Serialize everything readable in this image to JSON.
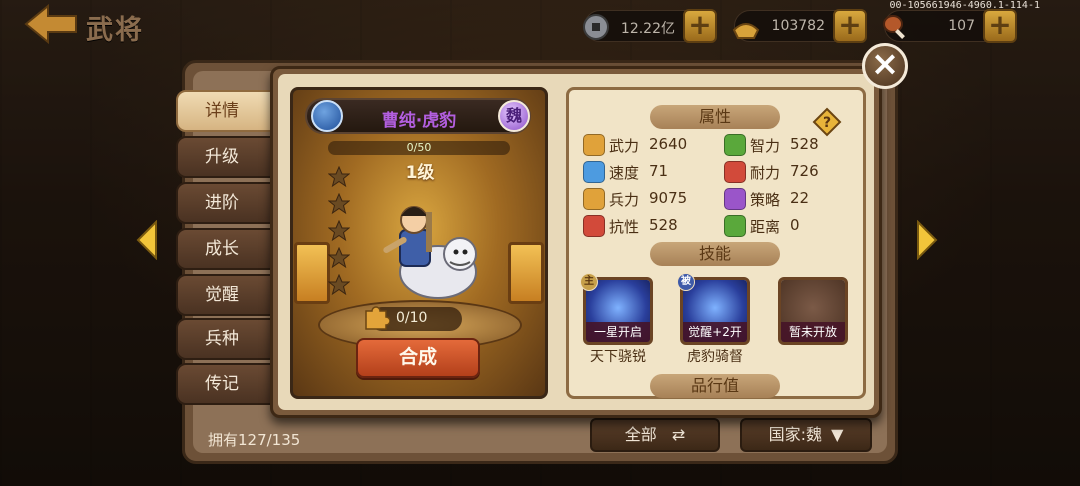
{
  "header": {
    "title": "武将",
    "server_code": "00-105661946-4960.1-114-1",
    "resources": [
      {
        "icon": "coin-icon",
        "value": "12.22亿"
      },
      {
        "icon": "gold-ingot-icon",
        "value": "103782"
      },
      {
        "icon": "drumstick-icon",
        "value": "107"
      }
    ]
  },
  "side_tabs": [
    "详情",
    "升级",
    "进阶",
    "成长",
    "觉醒",
    "兵种",
    "传记"
  ],
  "active_tab": 0,
  "footer": {
    "owned": "拥有127/135",
    "filter_all": "全部",
    "filter_country": "国家:魏"
  },
  "hero": {
    "name": "曹纯·虎豹",
    "kingdom": "魏",
    "exp_text": "0/50",
    "exp_fraction": 0,
    "level": "1级",
    "stars_filled": 0,
    "stars_total": 5,
    "fragments": "0/10",
    "compose_label": "合成"
  },
  "attributes": {
    "header": "属性",
    "items": [
      {
        "label": "武力",
        "value": "2640",
        "icon": "fist-icon",
        "color": "#e0a23a"
      },
      {
        "label": "智力",
        "value": "528",
        "icon": "leaf-icon",
        "color": "#5aa83b"
      },
      {
        "label": "速度",
        "value": "71",
        "icon": "boot-icon",
        "color": "#4d9be0"
      },
      {
        "label": "耐力",
        "value": "726",
        "icon": "heart-muscle-icon",
        "color": "#d24a3a"
      },
      {
        "label": "兵力",
        "value": "9075",
        "icon": "troops-icon",
        "color": "#e0a23a"
      },
      {
        "label": "策略",
        "value": "22",
        "icon": "scroll-icon",
        "color": "#9a55c9"
      },
      {
        "label": "抗性",
        "value": "528",
        "icon": "shield-icon",
        "color": "#d24a3a"
      },
      {
        "label": "距离",
        "value": "0",
        "icon": "range-icon",
        "color": "#5aa83b"
      }
    ]
  },
  "skills": {
    "header": "技能",
    "items": [
      {
        "tag": "一星开启",
        "name": "天下骁锐",
        "type": "主"
      },
      {
        "tag": "觉醒+2开启",
        "name": "虎豹骑督",
        "type": "被"
      },
      {
        "tag": "暂未开放",
        "name": "",
        "type": ""
      }
    ]
  },
  "next_section_header": "品行值"
}
